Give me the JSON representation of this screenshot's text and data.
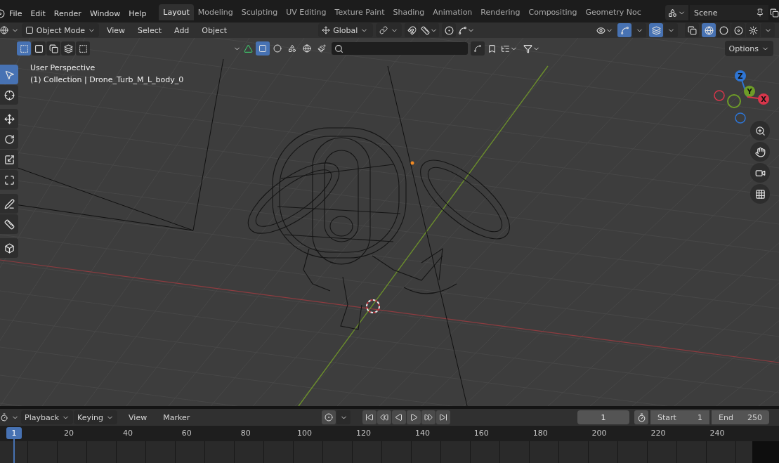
{
  "menu_bar": {
    "menus": [
      "File",
      "Edit",
      "Render",
      "Window",
      "Help"
    ],
    "workspaces": [
      {
        "label": "Layout",
        "selected": true
      },
      {
        "label": "Modeling",
        "selected": false
      },
      {
        "label": "Sculpting",
        "selected": false
      },
      {
        "label": "UV Editing",
        "selected": false
      },
      {
        "label": "Texture Paint",
        "selected": false
      },
      {
        "label": "Shading",
        "selected": false
      },
      {
        "label": "Animation",
        "selected": false
      },
      {
        "label": "Rendering",
        "selected": false
      },
      {
        "label": "Compositing",
        "selected": false
      },
      {
        "label": "Geometry Noc",
        "selected": false
      }
    ],
    "scene": "Scene"
  },
  "viewport_header": {
    "mode": "Object Mode",
    "menus": [
      "View",
      "Select",
      "Add",
      "Object"
    ],
    "orientation": "Global",
    "gizmos_on": true,
    "overlays_on": true,
    "shading": [
      {
        "kind": "wireframe",
        "selected": true
      },
      {
        "kind": "solid",
        "selected": false
      },
      {
        "kind": "material",
        "selected": false
      },
      {
        "kind": "rendered",
        "selected": false
      }
    ],
    "select_modes": [
      {
        "selected": true
      },
      {
        "selected": false
      },
      {
        "selected": false
      },
      {
        "selected": false
      },
      {
        "selected": false
      }
    ],
    "options": "Options"
  },
  "viewport": {
    "perspective": "User Perspective",
    "object_info": "(1) Collection | Drone_Turb_M_L_body_0",
    "tools": [
      {
        "kind": "select",
        "selected": true
      },
      {
        "kind": "cursor",
        "selected": false
      },
      {
        "kind": "move",
        "selected": false
      },
      {
        "kind": "rotate",
        "selected": false
      },
      {
        "kind": "scale",
        "selected": false
      },
      {
        "kind": "transform",
        "selected": false
      },
      {
        "kind": "annotate",
        "selected": false
      },
      {
        "kind": "measure",
        "selected": false
      },
      {
        "kind": "add_cube",
        "selected": false
      }
    ],
    "gizmo": [
      {
        "label": "Z",
        "color": "#2e75d4"
      },
      {
        "label": "Y",
        "color": "#6e9d28"
      },
      {
        "label": "X",
        "color": "#d8364b"
      }
    ]
  },
  "timeline": {
    "menus": [
      {
        "label": "Playback",
        "kind": "dropdown"
      },
      {
        "label": "Keying",
        "kind": "dropdown"
      },
      {
        "label": "View",
        "kind": "menu"
      },
      {
        "label": "Marker",
        "kind": "menu"
      }
    ],
    "current_frame": "1",
    "start_label": "Start",
    "start": "1",
    "end_label": "End",
    "end": "250",
    "playhead": "1",
    "ruler": [
      "20",
      "40",
      "60",
      "80",
      "100",
      "120",
      "140",
      "160",
      "180",
      "200",
      "220",
      "240"
    ]
  }
}
